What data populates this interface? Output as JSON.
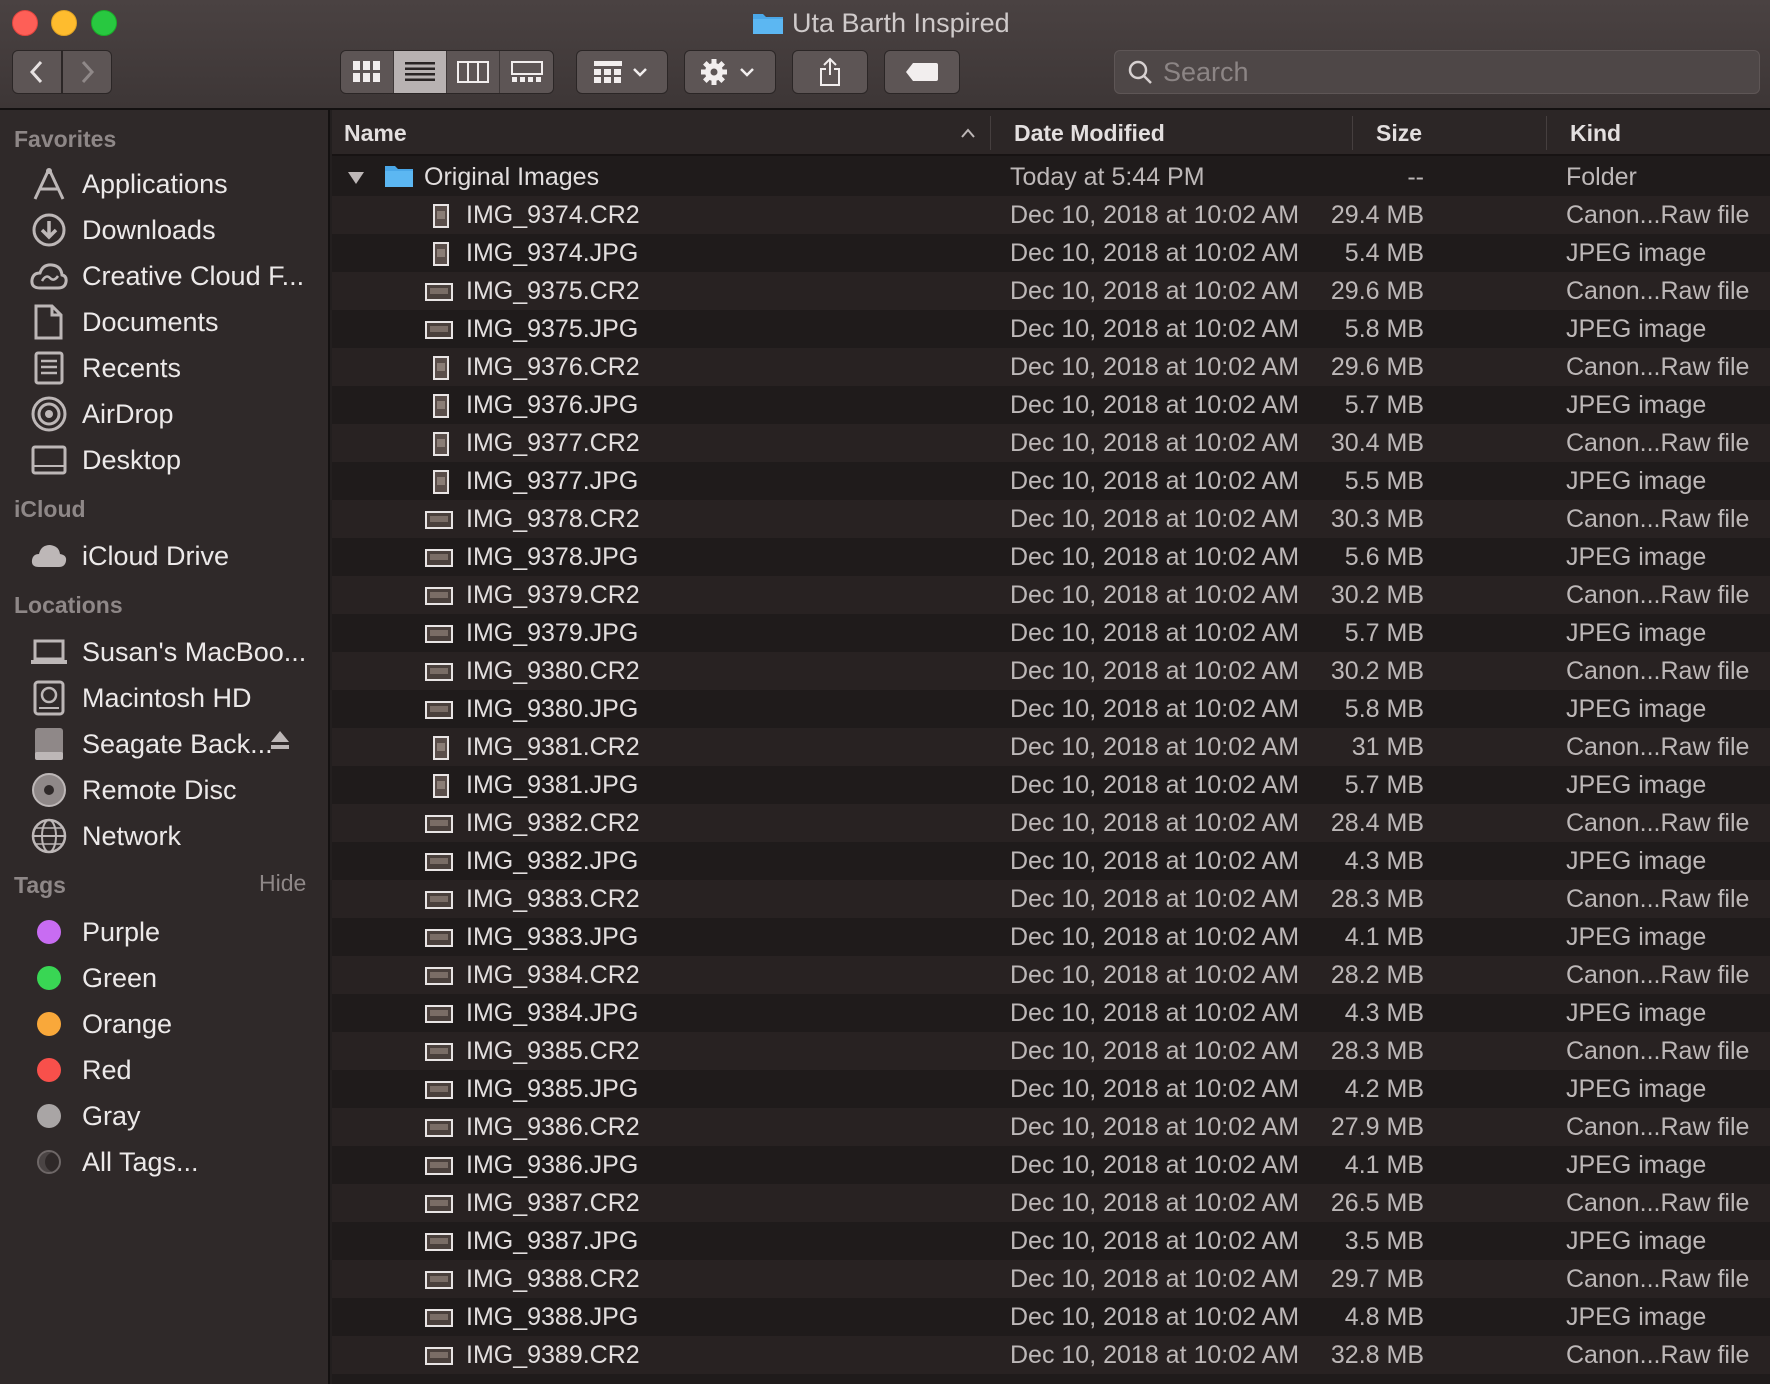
{
  "window": {
    "title": "Uta Barth Inspired"
  },
  "toolbar": {
    "search_placeholder": "Search"
  },
  "sidebar": {
    "favorites_heading": "Favorites",
    "favorites": [
      {
        "label": "Applications",
        "icon": "applications-icon"
      },
      {
        "label": "Downloads",
        "icon": "downloads-icon"
      },
      {
        "label": "Creative Cloud F...",
        "icon": "creative-cloud-icon"
      },
      {
        "label": "Documents",
        "icon": "documents-icon"
      },
      {
        "label": "Recents",
        "icon": "recents-icon"
      },
      {
        "label": "AirDrop",
        "icon": "airdrop-icon"
      },
      {
        "label": "Desktop",
        "icon": "desktop-icon"
      }
    ],
    "icloud_heading": "iCloud",
    "icloud": [
      {
        "label": "iCloud Drive",
        "icon": "cloud-icon"
      }
    ],
    "locations_heading": "Locations",
    "locations": [
      {
        "label": "Susan's MacBoo...",
        "icon": "laptop-icon"
      },
      {
        "label": "Macintosh HD",
        "icon": "hard-drive-icon"
      },
      {
        "label": "Seagate Back...",
        "icon": "external-drive-icon"
      },
      {
        "label": "Remote Disc",
        "icon": "disc-icon"
      },
      {
        "label": "Network",
        "icon": "network-icon"
      }
    ],
    "tags_heading": "Tags",
    "tags_hide": "Hide",
    "tags": [
      {
        "label": "Purple",
        "color": "#c86cf2"
      },
      {
        "label": "Green",
        "color": "#39d654"
      },
      {
        "label": "Orange",
        "color": "#f9a83a"
      },
      {
        "label": "Red",
        "color": "#f8504b"
      },
      {
        "label": "Gray",
        "color": "#a9a5a5"
      },
      {
        "label": "All Tags...",
        "color": "none"
      }
    ]
  },
  "columns": {
    "name": "Name",
    "date": "Date Modified",
    "size": "Size",
    "kind": "Kind"
  },
  "folder_row": {
    "name": "Original Images",
    "date": "Today at 5:44 PM",
    "size": "--",
    "kind": "Folder"
  },
  "files": [
    {
      "name": "IMG_9374.CR2",
      "date": "Dec 10, 2018 at 10:02 AM",
      "size": "29.4 MB",
      "kind": "Canon...Raw file",
      "orient": "portrait"
    },
    {
      "name": "IMG_9374.JPG",
      "date": "Dec 10, 2018 at 10:02 AM",
      "size": "5.4 MB",
      "kind": "JPEG image",
      "orient": "portrait"
    },
    {
      "name": "IMG_9375.CR2",
      "date": "Dec 10, 2018 at 10:02 AM",
      "size": "29.6 MB",
      "kind": "Canon...Raw file",
      "orient": "landscape"
    },
    {
      "name": "IMG_9375.JPG",
      "date": "Dec 10, 2018 at 10:02 AM",
      "size": "5.8 MB",
      "kind": "JPEG image",
      "orient": "landscape"
    },
    {
      "name": "IMG_9376.CR2",
      "date": "Dec 10, 2018 at 10:02 AM",
      "size": "29.6 MB",
      "kind": "Canon...Raw file",
      "orient": "portrait"
    },
    {
      "name": "IMG_9376.JPG",
      "date": "Dec 10, 2018 at 10:02 AM",
      "size": "5.7 MB",
      "kind": "JPEG image",
      "orient": "portrait"
    },
    {
      "name": "IMG_9377.CR2",
      "date": "Dec 10, 2018 at 10:02 AM",
      "size": "30.4 MB",
      "kind": "Canon...Raw file",
      "orient": "portrait"
    },
    {
      "name": "IMG_9377.JPG",
      "date": "Dec 10, 2018 at 10:02 AM",
      "size": "5.5 MB",
      "kind": "JPEG image",
      "orient": "portrait"
    },
    {
      "name": "IMG_9378.CR2",
      "date": "Dec 10, 2018 at 10:02 AM",
      "size": "30.3 MB",
      "kind": "Canon...Raw file",
      "orient": "landscape"
    },
    {
      "name": "IMG_9378.JPG",
      "date": "Dec 10, 2018 at 10:02 AM",
      "size": "5.6 MB",
      "kind": "JPEG image",
      "orient": "landscape"
    },
    {
      "name": "IMG_9379.CR2",
      "date": "Dec 10, 2018 at 10:02 AM",
      "size": "30.2 MB",
      "kind": "Canon...Raw file",
      "orient": "landscape"
    },
    {
      "name": "IMG_9379.JPG",
      "date": "Dec 10, 2018 at 10:02 AM",
      "size": "5.7 MB",
      "kind": "JPEG image",
      "orient": "landscape"
    },
    {
      "name": "IMG_9380.CR2",
      "date": "Dec 10, 2018 at 10:02 AM",
      "size": "30.2 MB",
      "kind": "Canon...Raw file",
      "orient": "landscape"
    },
    {
      "name": "IMG_9380.JPG",
      "date": "Dec 10, 2018 at 10:02 AM",
      "size": "5.8 MB",
      "kind": "JPEG image",
      "orient": "landscape"
    },
    {
      "name": "IMG_9381.CR2",
      "date": "Dec 10, 2018 at 10:02 AM",
      "size": "31 MB",
      "kind": "Canon...Raw file",
      "orient": "portrait"
    },
    {
      "name": "IMG_9381.JPG",
      "date": "Dec 10, 2018 at 10:02 AM",
      "size": "5.7 MB",
      "kind": "JPEG image",
      "orient": "portrait"
    },
    {
      "name": "IMG_9382.CR2",
      "date": "Dec 10, 2018 at 10:02 AM",
      "size": "28.4 MB",
      "kind": "Canon...Raw file",
      "orient": "landscape"
    },
    {
      "name": "IMG_9382.JPG",
      "date": "Dec 10, 2018 at 10:02 AM",
      "size": "4.3 MB",
      "kind": "JPEG image",
      "orient": "landscape"
    },
    {
      "name": "IMG_9383.CR2",
      "date": "Dec 10, 2018 at 10:02 AM",
      "size": "28.3 MB",
      "kind": "Canon...Raw file",
      "orient": "landscape"
    },
    {
      "name": "IMG_9383.JPG",
      "date": "Dec 10, 2018 at 10:02 AM",
      "size": "4.1 MB",
      "kind": "JPEG image",
      "orient": "landscape"
    },
    {
      "name": "IMG_9384.CR2",
      "date": "Dec 10, 2018 at 10:02 AM",
      "size": "28.2 MB",
      "kind": "Canon...Raw file",
      "orient": "landscape"
    },
    {
      "name": "IMG_9384.JPG",
      "date": "Dec 10, 2018 at 10:02 AM",
      "size": "4.3 MB",
      "kind": "JPEG image",
      "orient": "landscape"
    },
    {
      "name": "IMG_9385.CR2",
      "date": "Dec 10, 2018 at 10:02 AM",
      "size": "28.3 MB",
      "kind": "Canon...Raw file",
      "orient": "landscape"
    },
    {
      "name": "IMG_9385.JPG",
      "date": "Dec 10, 2018 at 10:02 AM",
      "size": "4.2 MB",
      "kind": "JPEG image",
      "orient": "landscape"
    },
    {
      "name": "IMG_9386.CR2",
      "date": "Dec 10, 2018 at 10:02 AM",
      "size": "27.9 MB",
      "kind": "Canon...Raw file",
      "orient": "landscape"
    },
    {
      "name": "IMG_9386.JPG",
      "date": "Dec 10, 2018 at 10:02 AM",
      "size": "4.1 MB",
      "kind": "JPEG image",
      "orient": "landscape"
    },
    {
      "name": "IMG_9387.CR2",
      "date": "Dec 10, 2018 at 10:02 AM",
      "size": "26.5 MB",
      "kind": "Canon...Raw file",
      "orient": "landscape"
    },
    {
      "name": "IMG_9387.JPG",
      "date": "Dec 10, 2018 at 10:02 AM",
      "size": "3.5 MB",
      "kind": "JPEG image",
      "orient": "landscape"
    },
    {
      "name": "IMG_9388.CR2",
      "date": "Dec 10, 2018 at 10:02 AM",
      "size": "29.7 MB",
      "kind": "Canon...Raw file",
      "orient": "landscape"
    },
    {
      "name": "IMG_9388.JPG",
      "date": "Dec 10, 2018 at 10:02 AM",
      "size": "4.8 MB",
      "kind": "JPEG image",
      "orient": "landscape"
    },
    {
      "name": "IMG_9389.CR2",
      "date": "Dec 10, 2018 at 10:02 AM",
      "size": "32.8 MB",
      "kind": "Canon...Raw file",
      "orient": "landscape"
    }
  ]
}
